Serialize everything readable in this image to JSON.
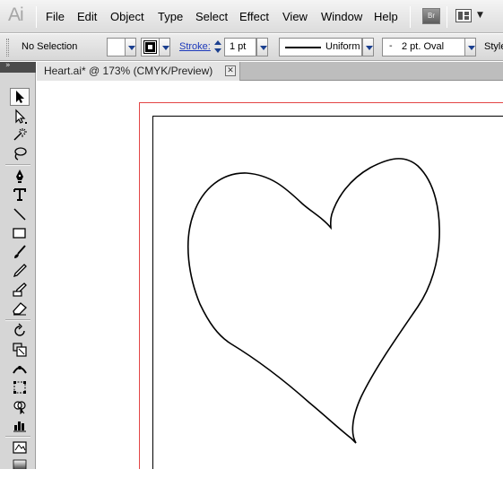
{
  "app": {
    "logo": "Ai"
  },
  "menu": {
    "items": [
      "File",
      "Edit",
      "Object",
      "Type",
      "Select",
      "Effect",
      "View",
      "Window",
      "Help"
    ],
    "bridge_label": "Br"
  },
  "control_bar": {
    "selection_label": "No Selection",
    "stroke_link": "Stroke:",
    "stroke_weight": "1 pt",
    "variable_width_profile": "Uniform",
    "brush_dash": "-",
    "brush": "2 pt. Oval",
    "style_label": "Style"
  },
  "toolbox": {
    "tools": [
      "selection-tool",
      "direct-selection-tool",
      "magic-wand-tool",
      "lasso-tool",
      "pen-tool",
      "type-tool",
      "line-segment-tool",
      "rectangle-tool",
      "paintbrush-tool",
      "pencil-tool",
      "blob-brush-tool",
      "eraser-tool",
      "rotate-tool",
      "scale-tool",
      "width-tool",
      "free-transform-tool",
      "shape-builder-tool",
      "graph-tool",
      "symbol-sprayer-tool",
      "gradient-tool"
    ],
    "collapse_glyph": "»"
  },
  "document": {
    "tab_title": "Heart.ai* @ 173% (CMYK/Preview)",
    "close_glyph": "✕"
  },
  "colors": {
    "bleed": "#e34545",
    "link": "#1c39bb",
    "path": "#000000"
  }
}
